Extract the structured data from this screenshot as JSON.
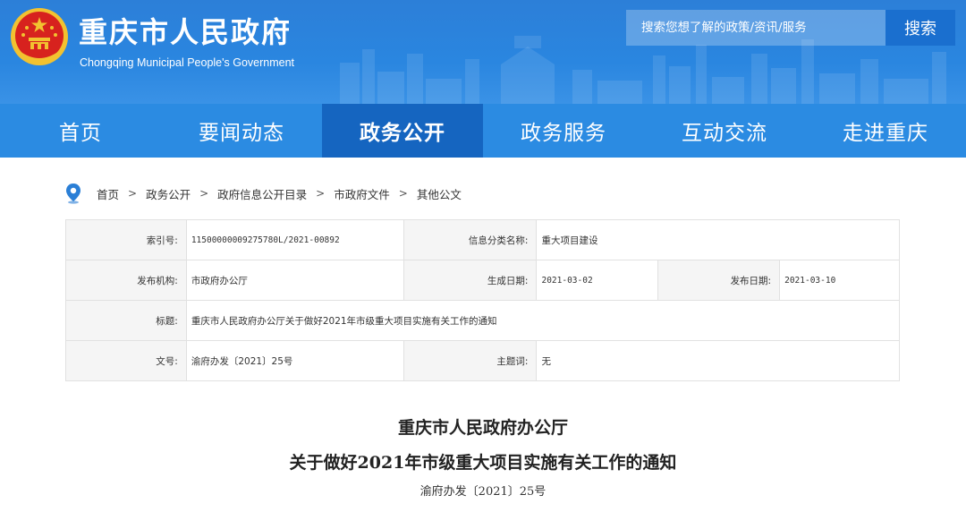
{
  "header": {
    "site_title": "重庆市人民政府",
    "site_subtitle": "Chongqing Municipal People's Government",
    "search_placeholder": "搜索您想了解的政策/资讯/服务",
    "search_button": "搜索"
  },
  "nav": {
    "items": [
      {
        "label": "首页"
      },
      {
        "label": "要闻动态"
      },
      {
        "label": "政务公开"
      },
      {
        "label": "政务服务"
      },
      {
        "label": "互动交流"
      },
      {
        "label": "走进重庆"
      }
    ],
    "active_index": 2
  },
  "breadcrumb": {
    "items": [
      "首页",
      "政务公开",
      "政府信息公开目录",
      "市政府文件",
      "其他公文"
    ],
    "separator": ">"
  },
  "info": {
    "index_label": "索引号:",
    "index_value": "11500000009275780L/2021-00892",
    "category_label": "信息分类名称:",
    "category_value": "重大项目建设",
    "issuer_label": "发布机构:",
    "issuer_value": "市政府办公厅",
    "created_label": "生成日期:",
    "created_value": "2021-03-02",
    "published_label": "发布日期:",
    "published_value": "2021-03-10",
    "title_label": "标题:",
    "title_value": "重庆市人民政府办公厅关于做好2021年市级重大项目实施有关工作的通知",
    "docno_label": "文号:",
    "docno_value": "渝府办发〔2021〕25号",
    "keyword_label": "主题词:",
    "keyword_value": "无"
  },
  "document": {
    "org": "重庆市人民政府办公厅",
    "title": "关于做好2021年市级重大项目实施有关工作的通知",
    "number": "渝府办发〔2021〕25号"
  },
  "colors": {
    "header_blue": "#2a86e0",
    "nav_blue": "#2b8be2",
    "nav_active": "#1565c0",
    "emblem_red": "#d7221e",
    "emblem_gold": "#f2c230"
  }
}
